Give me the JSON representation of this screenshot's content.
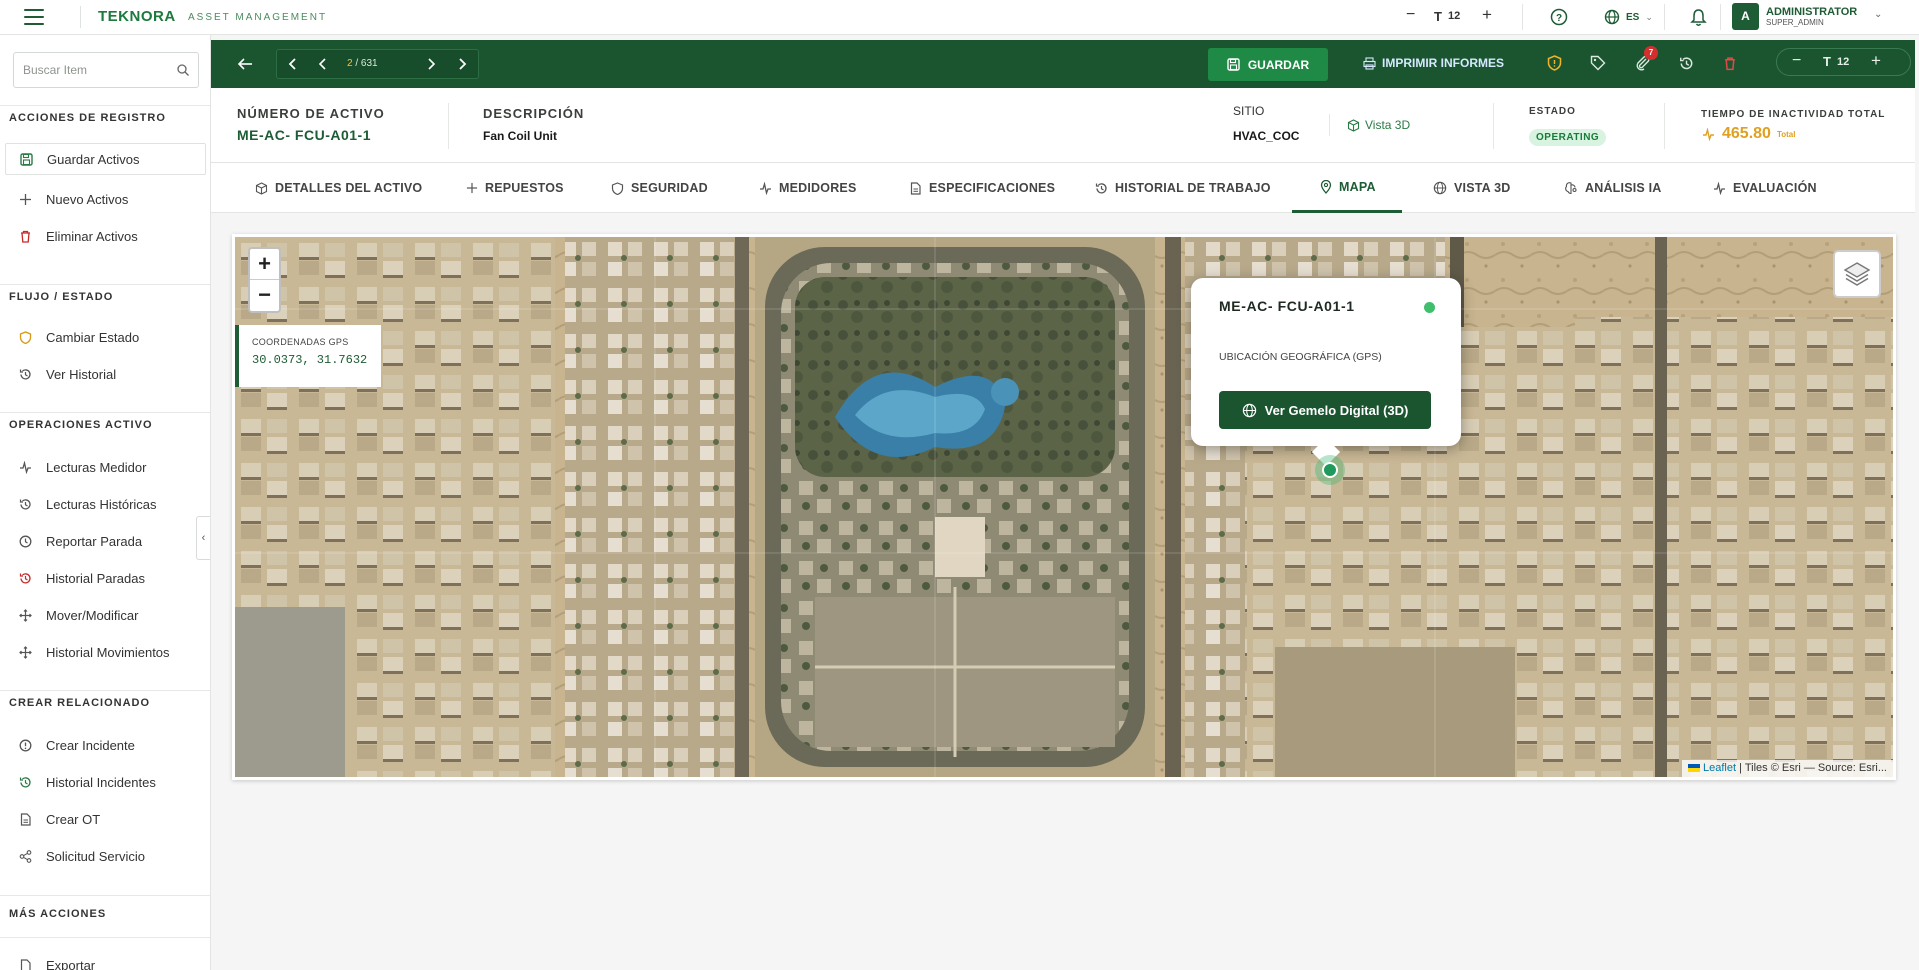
{
  "topbar": {
    "brand": "TEKNORA",
    "brand_sub": "ASSET MANAGEMENT",
    "font_size_value": "12",
    "language": "ES",
    "user_initial": "A",
    "user_name": "ADMINISTRATOR",
    "user_role": "SUPER_ADMIN"
  },
  "sidebar": {
    "search_placeholder": "Buscar Item",
    "sections": [
      {
        "title": "ACCIONES DE REGISTRO",
        "items": [
          "Guardar Activos",
          "Nuevo Activos",
          "Eliminar Activos"
        ]
      },
      {
        "title": "FLUJO / ESTADO",
        "items": [
          "Cambiar Estado",
          "Ver Historial"
        ]
      },
      {
        "title": "OPERACIONES ACTIVO",
        "items": [
          "Lecturas Medidor",
          "Lecturas Históricas",
          "Reportar Parada",
          "Historial Paradas",
          "Mover/Modificar",
          "Historial Movimientos"
        ]
      },
      {
        "title": "CREAR RELACIONADO",
        "items": [
          "Crear Incidente",
          "Historial Incidentes",
          "Crear OT",
          "Solicitud Servicio"
        ]
      },
      {
        "title": "MÁS ACCIONES",
        "items": [
          "Exportar"
        ]
      }
    ]
  },
  "actionbar": {
    "pager_current": "2",
    "pager_total": "/ 631",
    "save_label": "GUARDAR",
    "print_label": "IMPRIMIR INFORMES",
    "notif_count": "7",
    "zoom_value": "12"
  },
  "header": {
    "asset_number_label": "NÚMERO DE ACTIVO",
    "asset_number": "ME-AC- FCU-A01-1",
    "description_label": "DESCRIPCIÓN",
    "description": "Fan Coil Unit",
    "site_label": "SITIO",
    "site": "HVAC_COC",
    "view3d_link": "Vista 3D",
    "status_label": "ESTADO",
    "status": "OPERATING",
    "downtime_label": "TIEMPO DE INACTIVIDAD TOTAL",
    "downtime_value": "465.80",
    "downtime_unit": "Total"
  },
  "tabs": [
    {
      "label": "DETALLES DEL ACTIVO",
      "icon": "cube-icon"
    },
    {
      "label": "REPUESTOS",
      "icon": "plus-icon"
    },
    {
      "label": "SEGURIDAD",
      "icon": "shield-icon"
    },
    {
      "label": "MEDIDORES",
      "icon": "activity-icon"
    },
    {
      "label": "ESPECIFICACIONES",
      "icon": "document-icon"
    },
    {
      "label": "HISTORIAL DE TRABAJO",
      "icon": "history-icon"
    },
    {
      "label": "MAPA",
      "icon": "map-pin-icon",
      "active": true
    },
    {
      "label": "VISTA 3D",
      "icon": "globe-icon"
    },
    {
      "label": "ANÁLISIS IA",
      "icon": "brain-icon"
    },
    {
      "label": "EVALUACIÓN",
      "icon": "activity-icon"
    }
  ],
  "map": {
    "gps_label": "COORDENADAS GPS",
    "gps_value": "30.0373, 31.7632",
    "popup_title": "ME-AC- FCU-A01-1",
    "popup_subtitle": "UBICACIÓN GEOGRÁFICA (GPS)",
    "popup_button": "Ver Gemelo Digital (3D)",
    "attribution_link": "Leaflet",
    "attribution_text": "| Tiles © Esri — Source: Esri..."
  },
  "colors": {
    "brand_green": "#1a5530",
    "accent_green": "#1f8a45",
    "status_bg": "#d8f3df",
    "downtime": "#e0a020"
  }
}
